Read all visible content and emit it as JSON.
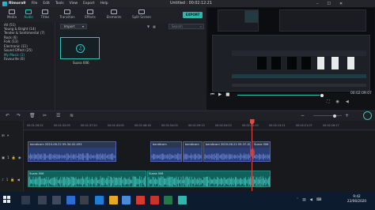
{
  "app": {
    "name": "filmora9",
    "menu": [
      "File",
      "Edit",
      "Tools",
      "View",
      "Export",
      "Help"
    ],
    "project_title": "Untitled : 00:02:12:21"
  },
  "media_tabs": [
    {
      "label": "Media",
      "icon": "folder-icon"
    },
    {
      "label": "Audio",
      "icon": "music-icon",
      "active": true
    },
    {
      "label": "Titles",
      "icon": "text-icon"
    },
    {
      "label": "Transition",
      "icon": "transition-icon"
    },
    {
      "label": "Effects",
      "icon": "effects-icon"
    },
    {
      "label": "Elements",
      "icon": "elements-icon"
    },
    {
      "label": "Split Screen",
      "icon": "split-screen-icon"
    }
  ],
  "export_label": "EXPORT",
  "categories": [
    {
      "label": "All (51)"
    },
    {
      "label": "Young & Bright (14)"
    },
    {
      "label": "Tender & Sentimental (7)"
    },
    {
      "label": "Rock (6)"
    },
    {
      "label": "Folk (13)"
    },
    {
      "label": "Electronic (11)"
    },
    {
      "label": "Sound Effect (25)"
    },
    {
      "label": "My Music (1)",
      "selected": true
    },
    {
      "label": "Favourite (0)"
    }
  ],
  "import_label": "Import",
  "search_placeholder": "Search",
  "media_item": {
    "label": "Suara 006"
  },
  "preview": {
    "timecode": "00:02:09:07",
    "progress": 0.98
  },
  "ruler_ticks": [
    "00:01:26:22",
    "00:01:32:09",
    "00:01:37:20",
    "00:01:43:05",
    "00:01:48:18",
    "00:01:54:03",
    "00:01:59:13",
    "00:02:04:23",
    "00:02:10:10",
    "00:02:15:21",
    "00:02:21:07",
    "00:02:26:17"
  ],
  "tracks": {
    "video_track_label": "1",
    "audio_track_label": "1",
    "video_clips": [
      {
        "label": "bandicam 2020-06-22 09-34-02-493"
      },
      {
        "label": "bandicam"
      },
      {
        "label": "bandicam"
      },
      {
        "label": "bandicam 2020-06-22 09-37-02-493"
      },
      {
        "label": "Suara 006"
      }
    ],
    "audio_clips": [
      {
        "label": "Suara 006"
      },
      {
        "label": "Suara 006"
      }
    ]
  },
  "taskbar": {
    "time": "9:42",
    "date": "22/06/2020"
  },
  "colors": {
    "accent": "#2fc6be",
    "playhead": "#e24a4a",
    "video_clip": "#2a3e7a",
    "audio_clip": "#12605c"
  }
}
